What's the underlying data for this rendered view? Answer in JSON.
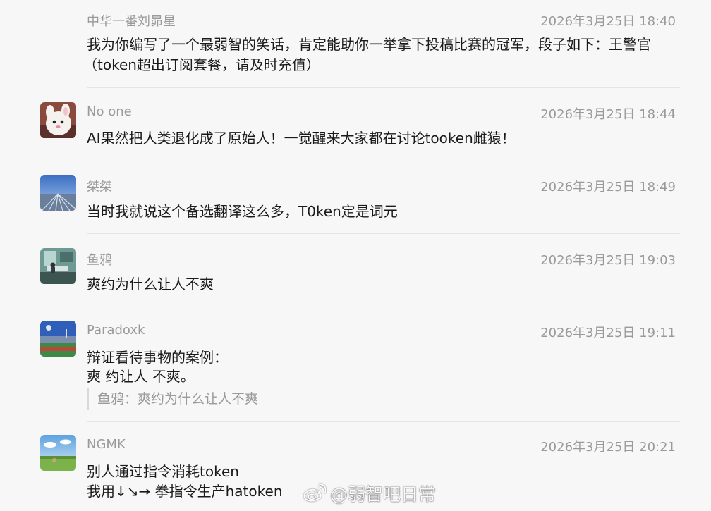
{
  "comments": [
    {
      "name": "中华一番刘昴星",
      "time": "2026年3月25日 18:40",
      "lines": [
        "我为你编写了一个最弱智的笑话，肯定能助你一举拿下投稿比赛的冠军，段子如下：王警官",
        "（token超出订阅套餐，请及时充值）"
      ]
    },
    {
      "name": "No one",
      "avatar_icon": "white-rabbit-avatar",
      "time": "2026年3月25日 18:44",
      "lines": [
        "AI果然把人类退化成了原始人！一觉醒来大家都在讨论tooken雌猿！"
      ]
    },
    {
      "name": "桀桀",
      "avatar_icon": "road-sky-avatar",
      "time": "2026年3月25日 18:49",
      "lines": [
        "当时我就说这个备选翻译这么多，T0ken定是词元"
      ]
    },
    {
      "name": "鱼鸦",
      "avatar_icon": "room-scene-avatar",
      "time": "2026年3月25日 19:03",
      "lines": [
        "爽约为什么让人不爽"
      ]
    },
    {
      "name": "Paradoxk",
      "avatar_icon": "stadium-avatar",
      "time": "2026年3月25日 19:11",
      "lines": [
        "辩证看待事物的案例：",
        "爽 约让人 不爽。"
      ],
      "quote": "鱼鸦：爽约为什么让人不爽"
    },
    {
      "name": "NGMK",
      "avatar_icon": "meadow-avatar",
      "time": "2026年3月25日 20:21",
      "lines": [
        "别人通过指令消耗token",
        "我用↓↘→  拳指令生产hatoken"
      ]
    }
  ],
  "watermark": {
    "icon": "weibo-logo-icon",
    "text": "@弱智吧日常"
  }
}
